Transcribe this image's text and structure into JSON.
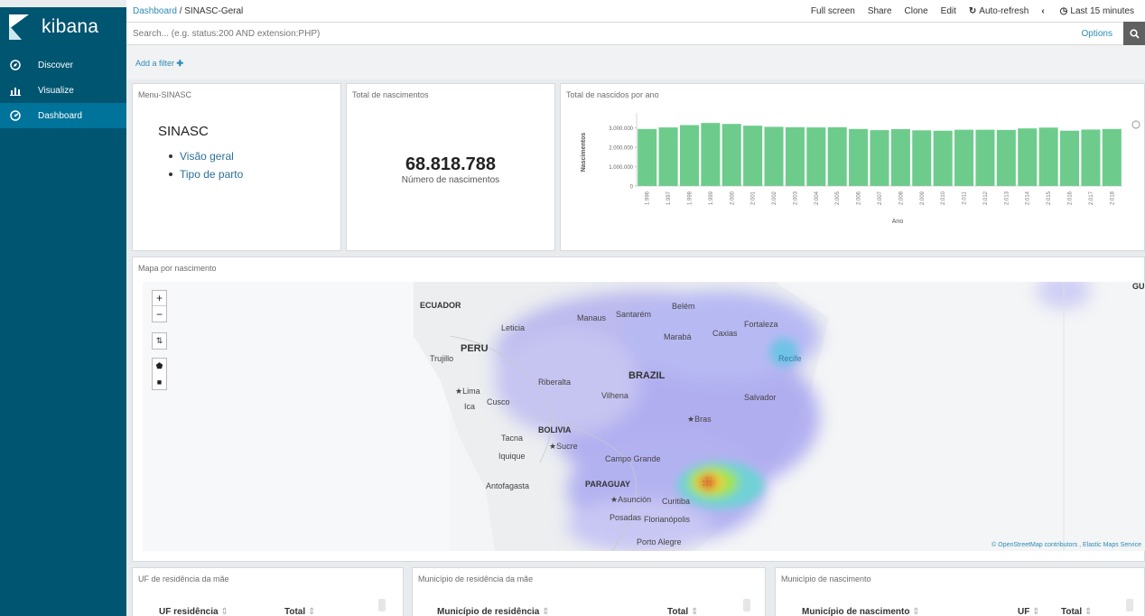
{
  "app": {
    "name": "kibana"
  },
  "sidebar": {
    "items": [
      {
        "label": "Discover",
        "icon": "compass-icon"
      },
      {
        "label": "Visualize",
        "icon": "bar-chart-icon"
      },
      {
        "label": "Dashboard",
        "icon": "dashboard-icon",
        "active": true
      }
    ]
  },
  "header": {
    "breadcrumb_root": "Dashboard",
    "breadcrumb_sep": "/",
    "breadcrumb_current": "SINASC-Geral",
    "actions": {
      "fullscreen": "Full screen",
      "share": "Share",
      "clone": "Clone",
      "edit": "Edit",
      "autorefresh": "Auto-refresh",
      "timerange": "Last 15 minutes"
    }
  },
  "search": {
    "placeholder": "Search... (e.g. status:200 AND extension:PHP)",
    "options_label": "Options"
  },
  "filter": {
    "add_label": "Add a filter"
  },
  "panels": {
    "menu": {
      "title": "Menu-SINASC",
      "heading": "SINASC",
      "links": [
        "Visão geral",
        "Tipo de parto"
      ]
    },
    "total": {
      "title": "Total de nascimentos",
      "value": "68.818.788",
      "label": "Número de nascimentos"
    },
    "chart": {
      "title": "Total de nascidos por ano"
    },
    "map": {
      "title": "Mapa por nascimento",
      "labels": {
        "ecuador": "ECUADOR",
        "peru": "PERU",
        "brazil": "BRAZIL",
        "bolivia": "BOLIVIA",
        "paraguay": "PARAGUAY",
        "leticia": "Leticia",
        "manaus": "Manaus",
        "santarem": "Santarém",
        "belem": "Belém",
        "fortaleza": "Fortaleza",
        "maraba": "Marabá",
        "caxias": "Caxias",
        "recife": "Recife",
        "trujillo": "Trujillo",
        "riberalta": "Riberalta",
        "vilhena": "Vilhena",
        "salvador": "Salvador",
        "lima": "Lima",
        "cusco": "Cusco",
        "ica": "Ica",
        "bras": "Bras",
        "tacna": "Tacna",
        "sucre": "Sucre",
        "iquique": "Iquique",
        "campo_grande": "Campo Grande",
        "antofagasta": "Antofagasta",
        "asuncion": "Asunción",
        "curitiba": "Curitiba",
        "posadas": "Posadas",
        "florianopolis": "Florianópolis",
        "porto_alegre": "Porto Alegre",
        "gu": "GU"
      },
      "attribution": "© OpenStreetMap contributors , Elastic Maps Service"
    },
    "uf": {
      "title": "UF de residência da mãe",
      "col1": "UF residência",
      "col2": "Total"
    },
    "mun": {
      "title": "Município de residência da mãe",
      "col1": "Município de residência",
      "col2": "Total"
    },
    "nasc": {
      "title": "Município de nascimento",
      "col1": "Município de nascimento",
      "col2": "UF",
      "col3": "Total"
    }
  },
  "chart_data": {
    "type": "bar",
    "title": "Total de nascidos por ano",
    "xlabel": "Ano",
    "ylabel": "Nascimentos",
    "ylim": [
      0,
      3500000
    ],
    "yticks": [
      "3.000.000",
      "2.000.000",
      "1.000.000",
      "0"
    ],
    "ytick_values": [
      3000000,
      2000000,
      1000000,
      0
    ],
    "categories": [
      "1.996",
      "1.997",
      "1.998",
      "1.999",
      "2.000",
      "2.001",
      "2.002",
      "2.003",
      "2.004",
      "2.005",
      "2.006",
      "2.007",
      "2.008",
      "2.009",
      "2.010",
      "2.011",
      "2.012",
      "2.013",
      "2.014",
      "2.015",
      "2.016",
      "2.017",
      "2.018"
    ],
    "values": [
      2950000,
      3030000,
      3150000,
      3260000,
      3210000,
      3120000,
      3060000,
      3040000,
      3030000,
      3040000,
      2950000,
      2890000,
      2940000,
      2880000,
      2860000,
      2910000,
      2910000,
      2900000,
      2980000,
      3020000,
      2860000,
      2920000,
      2950000
    ],
    "color": "#6dcc8c",
    "grid": false
  },
  "colors": {
    "sidebar": "#005571",
    "sidebar_active": "#00739a",
    "link": "#2d8bb5",
    "bar": "#6dcc8c"
  }
}
